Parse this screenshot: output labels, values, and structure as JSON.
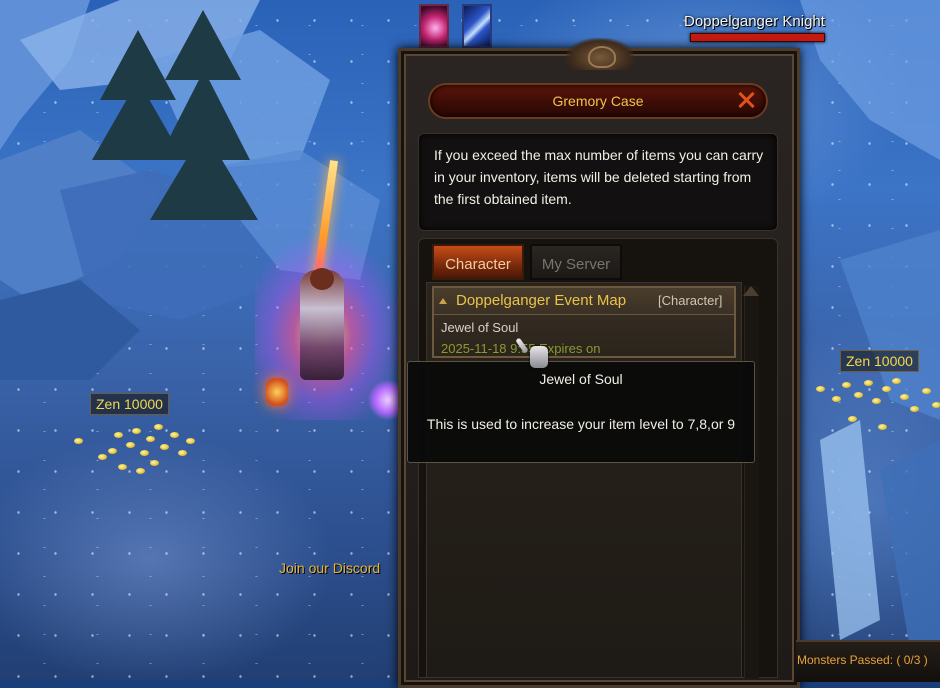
{
  "hud": {
    "target_name": "Doppelganger Knight",
    "target_hp_fraction": 1.0,
    "buffs": [
      "pink-spiral-buff-icon",
      "blue-blade-buff-icon"
    ]
  },
  "world": {
    "zen_left": "Zen 10000",
    "zen_right": "Zen 10000",
    "discord_link": "Join our Discord"
  },
  "gremory": {
    "title": "Gremory Case",
    "info": "If you exceed the max number of items you can carry in your inventory, items will be deleted starting from the first obtained item.",
    "tabs": [
      {
        "label": "Character",
        "active": true
      },
      {
        "label": "My Server",
        "active": false
      }
    ],
    "items": [
      {
        "event": "Doppelganger Event Map",
        "tag": "[Character]",
        "item_name": "Jewel of Soul",
        "date": "2025-11-18 9:55 Expires on"
      }
    ]
  },
  "tooltip": {
    "title": "Jewel of Soul",
    "description": "This is used to increase your item level to 7,8,or 9"
  },
  "status": {
    "monsters_passed": "Monsters Passed: ( 0/3 )"
  },
  "colors": {
    "gold_text": "#f0c548",
    "tab_active": "#c74d18",
    "hp_bar": "#c61a12"
  }
}
